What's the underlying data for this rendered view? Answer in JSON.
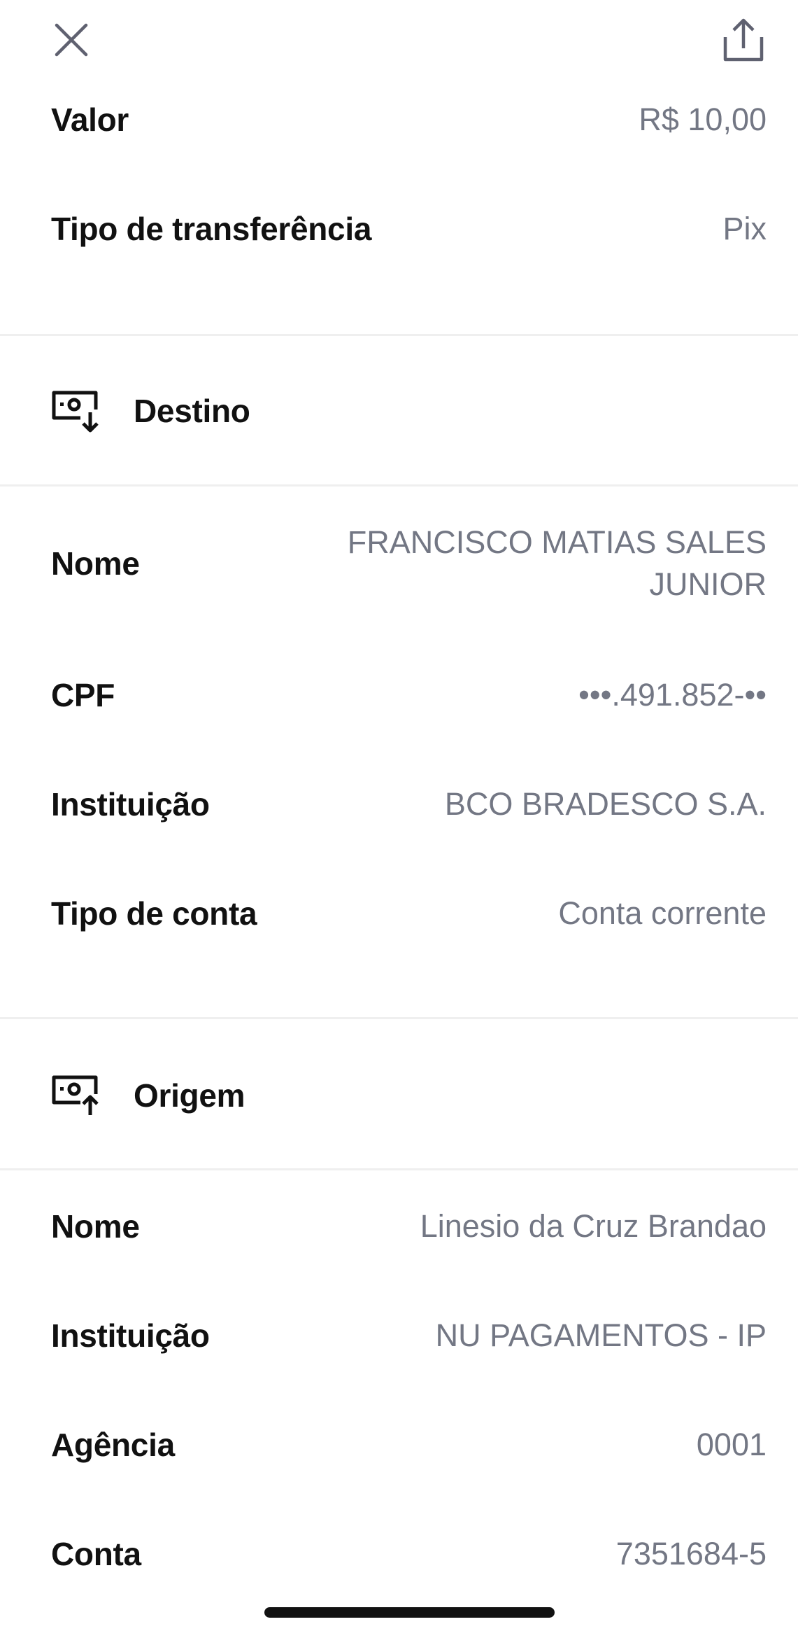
{
  "header": {
    "close_icon": "close-icon",
    "share_icon": "share-icon"
  },
  "summary": {
    "valor_label": "Valor",
    "valor_value": "R$ 10,00",
    "tipo_transferencia_label": "Tipo de transferência",
    "tipo_transferencia_value": "Pix"
  },
  "destino": {
    "title": "Destino",
    "icon": "money-receive-icon",
    "nome_label": "Nome",
    "nome_value": "FRANCISCO MATIAS SALES JUNIOR",
    "cpf_label": "CPF",
    "cpf_value": "•••.491.852-••",
    "instituicao_label": "Instituição",
    "instituicao_value": "BCO BRADESCO S.A.",
    "tipo_conta_label": "Tipo de conta",
    "tipo_conta_value": "Conta corrente"
  },
  "origem": {
    "title": "Origem",
    "icon": "money-send-icon",
    "nome_label": "Nome",
    "nome_value": "Linesio da Cruz Brandao",
    "instituicao_label": "Instituição",
    "instituicao_value": "NU PAGAMENTOS - IP",
    "agencia_label": "Agência",
    "agencia_value": "0001",
    "conta_label": "Conta",
    "conta_value": "7351684-5"
  },
  "colors": {
    "label": "#111111",
    "value": "#737784",
    "icon": "#5f6170",
    "divider": "#efefef"
  }
}
